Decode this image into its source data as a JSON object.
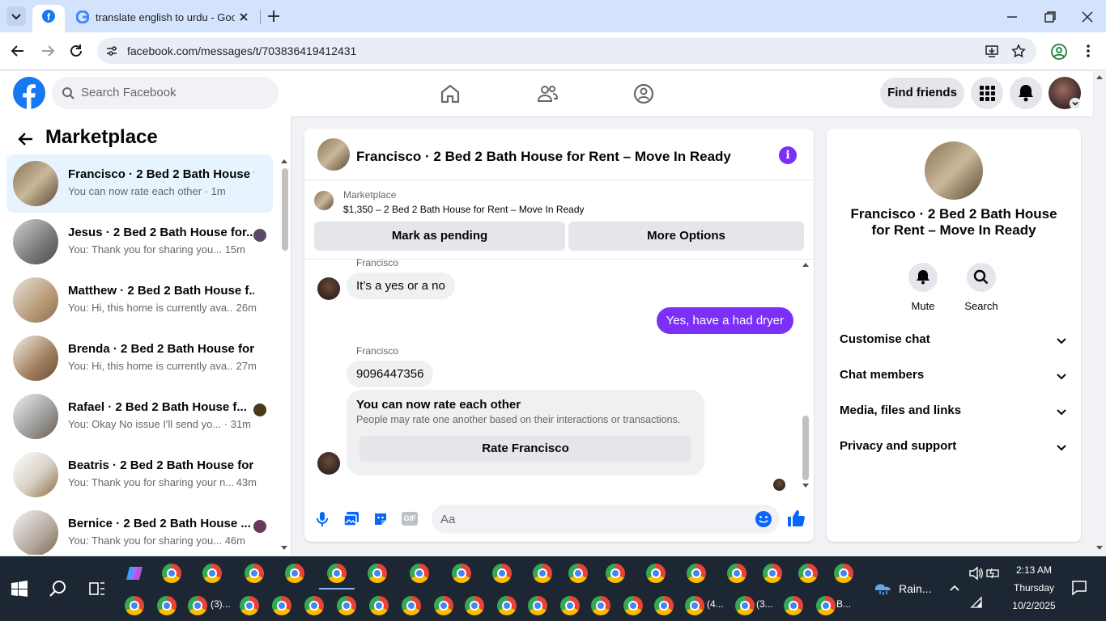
{
  "browser": {
    "tab_title": "translate english to urdu - Goo",
    "url": "facebook.com/messages/t/703836419412431"
  },
  "fb_header": {
    "search_placeholder": "Search Facebook",
    "find_friends": "Find friends"
  },
  "sidebar": {
    "title": "Marketplace",
    "conversations": [
      {
        "name": "Francisco · 2 Bed 2 Bath House f...",
        "preview": "You can now rate each other",
        "time": "· 1m"
      },
      {
        "name": "Jesus · 2 Bed 2 Bath House for...",
        "preview": "You: Thank you for sharing you...",
        "time": "15m"
      },
      {
        "name": "Matthew · 2 Bed 2 Bath House f...",
        "preview": "You: Hi, this home is currently ava...",
        "time": "26m"
      },
      {
        "name": "Brenda · 2 Bed 2 Bath House for...",
        "preview": "You: Hi, this home is currently ava...",
        "time": "27m"
      },
      {
        "name": "Rafael · 2 Bed 2 Bath House f...",
        "preview": "You: Okay No issue I'll send yo...",
        "time": "· 31m"
      },
      {
        "name": "Beatris · 2 Bed 2 Bath House for ...",
        "preview": "You: Thank you for sharing your n...",
        "time": "43m"
      },
      {
        "name": "Bernice · 2 Bed 2 Bath House ...",
        "preview": "You: Thank you for sharing you...",
        "time": "46m"
      }
    ]
  },
  "chat": {
    "title": "Francisco · 2 Bed 2 Bath House for Rent – Move In Ready",
    "listing_label": "Marketplace",
    "listing_desc": "$1,350 – 2 Bed 2 Bath House for Rent – Move In Ready",
    "mark_pending": "Mark as pending",
    "more_options": "More Options",
    "messages": [
      {
        "sender": "Francisco",
        "text": "It’s a yes or a no"
      },
      {
        "text": "Yes, have a had dryer"
      },
      {
        "sender": "Francisco",
        "text": "9096447356"
      }
    ],
    "rate_card": {
      "heading": "You can now rate each other",
      "sub": "People may rate one another based on their interactions or transactions.",
      "button": "Rate Francisco"
    },
    "composer_placeholder": "Aa",
    "gif_label": "GIF"
  },
  "info_panel": {
    "name": "Francisco · 2 Bed 2 Bath House for Rent – Move In Ready",
    "mute": "Mute",
    "search": "Search",
    "sections": [
      "Customise chat",
      "Chat members",
      "Media, files and links",
      "Privacy and support"
    ]
  },
  "taskbar": {
    "weather": "Rain...",
    "time": "2:13 AM",
    "day": "Thursday",
    "date": "10/2/2025",
    "label_a": "(3)...",
    "label_b": "(4...",
    "label_c": "(3...",
    "label_d": "B..."
  },
  "colors": {
    "fb_blue": "#1877f2",
    "messenger_purple": "#7b2ff7"
  }
}
